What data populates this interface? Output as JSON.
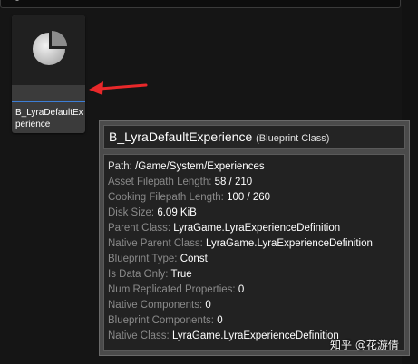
{
  "asset": {
    "tile_name": "B_LyraDefaultExperience",
    "thumbnail_icon": "pie-chart-icon",
    "tile_accent": "#3d7ed6"
  },
  "annotation": {
    "arrow_color": "#e8282a"
  },
  "tooltip": {
    "title": "B_LyraDefaultExperience",
    "kind": "(Blueprint Class)",
    "properties": [
      {
        "key": "Path:",
        "value": "/Game/System/Experiences",
        "key_bright": true
      },
      {
        "key": "Asset Filepath Length:",
        "value": "58 / 210",
        "key_bright": false
      },
      {
        "key": "Cooking Filepath Length:",
        "value": "100 / 260",
        "key_bright": false
      },
      {
        "key": "Disk Size:",
        "value": "6.09 KiB",
        "key_bright": false
      },
      {
        "key": "Parent Class:",
        "value": "LyraGame.LyraExperienceDefinition",
        "key_bright": false
      },
      {
        "key": "Native Parent Class:",
        "value": "LyraGame.LyraExperienceDefinition",
        "key_bright": false
      },
      {
        "key": "Blueprint Type:",
        "value": "Const",
        "key_bright": false
      },
      {
        "key": "Is Data Only:",
        "value": "True",
        "key_bright": false
      },
      {
        "key": "Num Replicated Properties:",
        "value": "0",
        "key_bright": false
      },
      {
        "key": "Native Components:",
        "value": "0",
        "key_bright": false
      },
      {
        "key": "Blueprint Components:",
        "value": "0",
        "key_bright": false
      },
      {
        "key": "Native Class:",
        "value": "LyraGame.LyraExperienceDefinition",
        "key_bright": false
      }
    ]
  },
  "watermark": {
    "text": "知乎 @花游倩"
  }
}
